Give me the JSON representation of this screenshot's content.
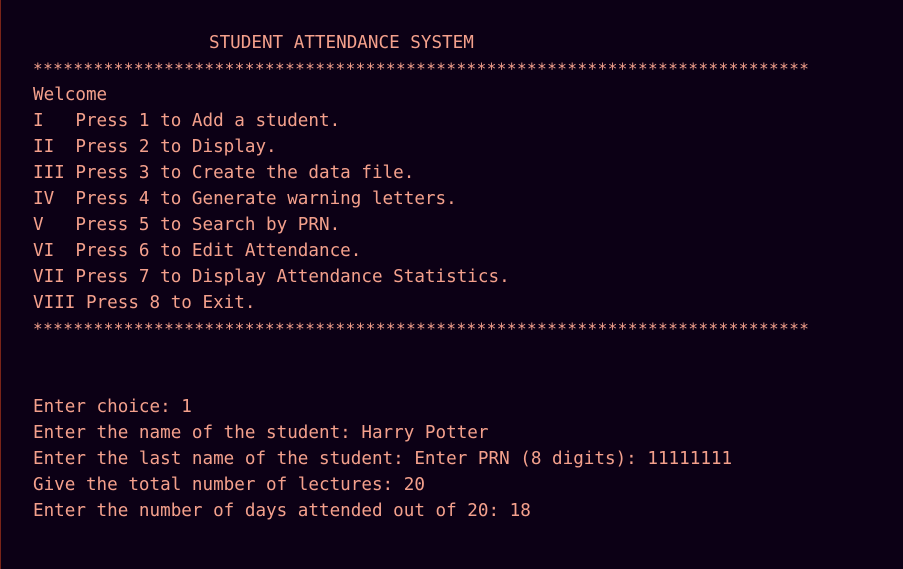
{
  "colors": {
    "background": "#0c0015",
    "text": "#f4a08c",
    "left_border": "#7a2418"
  },
  "header": {
    "title": "STUDENT ATTENDANCE SYSTEM",
    "separator": "*****************************************************************************"
  },
  "menu": {
    "welcome": "Welcome",
    "items": [
      {
        "label": "I   Press 1 to Add a student."
      },
      {
        "label": "II  Press 2 to Display."
      },
      {
        "label": "III Press 3 to Create the data file."
      },
      {
        "label": "IV  Press 4 to Generate warning letters."
      },
      {
        "label": "V   Press 5 to Search by PRN."
      },
      {
        "label": "VI  Press 6 to Edit Attendance."
      },
      {
        "label": "VII Press 7 to Display Attendance Statistics."
      },
      {
        "label": "VIII Press 8 to Exit."
      }
    ],
    "separator": "*****************************************************************************"
  },
  "session": {
    "lines": [
      {
        "text": "Enter choice: 1"
      },
      {
        "text": "Enter the name of the student: Harry Potter"
      },
      {
        "text": "Enter the last name of the student: Enter PRN (8 digits): 11111111"
      },
      {
        "text": "Give the total number of lectures: 20"
      },
      {
        "text": "Enter the number of days attended out of 20: 18"
      }
    ]
  }
}
